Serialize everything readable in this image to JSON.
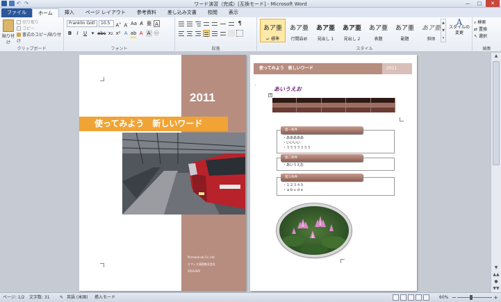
{
  "window": {
    "title": "ワード演習（完成）[互換モード] - Microsoft Word",
    "controls": [
      "—",
      "□",
      "✕"
    ]
  },
  "tabs": [
    {
      "label": "ファイル"
    },
    {
      "label": "ホーム"
    },
    {
      "label": "挿入"
    },
    {
      "label": "ページ レイアウト"
    },
    {
      "label": "参考資料"
    },
    {
      "label": "差し込み文書"
    },
    {
      "label": "校閲"
    },
    {
      "label": "表示"
    }
  ],
  "ribbon": {
    "clipboard": {
      "label": "クリップボード",
      "paste": "貼り付け",
      "cut": "切り取り",
      "copy": "コピー",
      "format_painter": "書式のコピー/貼り付け"
    },
    "font": {
      "label": "フォント",
      "font_name": "Franklin Gotl",
      "font_size": "10.5"
    },
    "paragraph": {
      "label": "段落"
    },
    "styles": {
      "label": "スタイル",
      "items": [
        {
          "sample": "あア亜",
          "name": "↵ 標準"
        },
        {
          "sample": "あア亜",
          "name": "行間詰め"
        },
        {
          "sample": "あア亜",
          "name": "見出し 1"
        },
        {
          "sample": "あア亜",
          "name": "見出し 2"
        },
        {
          "sample": "あア亜",
          "name": "表題"
        },
        {
          "sample": "あア亜",
          "name": "副題"
        },
        {
          "sample": "あア亜",
          "name": "斜体"
        }
      ],
      "change_styles": "スタイルの変更"
    },
    "editing": {
      "label": "編集",
      "find": "検索",
      "replace": "置換",
      "select": "選択"
    }
  },
  "page1": {
    "year": "2011",
    "title": "使ってみよう　新しいワード",
    "company_en": "Personal ab Co. Ltd.",
    "company_jp": "オフィス演習株式会社",
    "date": "2011/0/0"
  },
  "page2": {
    "header_text": "使ってみよう　新しいワード",
    "header_year": "2011",
    "heading": "あいうえお",
    "conditions": [
      {
        "title": "第一条件",
        "items": [
          "・あああああ",
          "・いいいい",
          "・ううううううう"
        ]
      },
      {
        "title": "第二条件",
        "items": [
          "・あいうえお"
        ]
      },
      {
        "title": "第三条件",
        "items": [
          "・１２３４５",
          "・ａｂｃｄｅ"
        ]
      }
    ]
  },
  "statusbar": {
    "page": "ページ: 1/2",
    "words": "文字数: 31",
    "language": "英語 (米国)",
    "mode": "挿入モード",
    "zoom": "60%"
  },
  "colors": {
    "accent_brown": "#b78d80",
    "title_orange": "#f0a436",
    "file_tab": "#2b579a"
  }
}
